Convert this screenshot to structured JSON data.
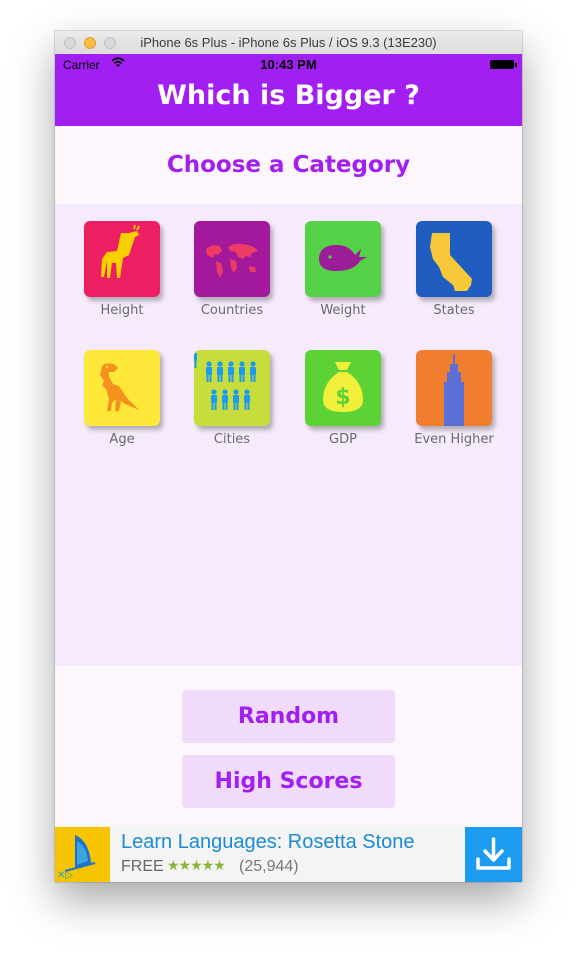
{
  "window": {
    "title": "iPhone 6s Plus - iPhone 6s Plus / iOS 9.3 (13E230)"
  },
  "status_bar": {
    "carrier": "Carrier",
    "time": "10:43 PM"
  },
  "app": {
    "title": "Which is Bigger ?"
  },
  "section": {
    "heading": "Choose a Category"
  },
  "categories": [
    {
      "label": "Height",
      "color": "#ec1f63",
      "icon": "giraffe-icon"
    },
    {
      "label": "Countries",
      "color": "#a3199b",
      "icon": "world-map-icon"
    },
    {
      "label": "Weight",
      "color": "#55d248",
      "icon": "whale-icon"
    },
    {
      "label": "States",
      "color": "#1f5ec0",
      "icon": "california-icon"
    },
    {
      "label": "Age",
      "color": "#fde739",
      "icon": "dinosaur-icon"
    },
    {
      "label": "Cities",
      "color": "#c6dd3b",
      "icon": "people-icon"
    },
    {
      "label": "GDP",
      "color": "#5dd235",
      "icon": "money-bag-icon"
    },
    {
      "label": "Even Higher",
      "color": "#f07e2e",
      "icon": "skyscraper-icon"
    }
  ],
  "buttons": {
    "random": "Random",
    "high_scores": "High Scores"
  },
  "ad": {
    "title": "Learn Languages: Rosetta Stone",
    "price": "FREE",
    "stars": "★★★★★",
    "rating_count": "(25,944)"
  },
  "colors": {
    "accent": "#a21ff1",
    "button_bg": "#f0dcfa",
    "grid_bg": "#f6ebfc"
  }
}
